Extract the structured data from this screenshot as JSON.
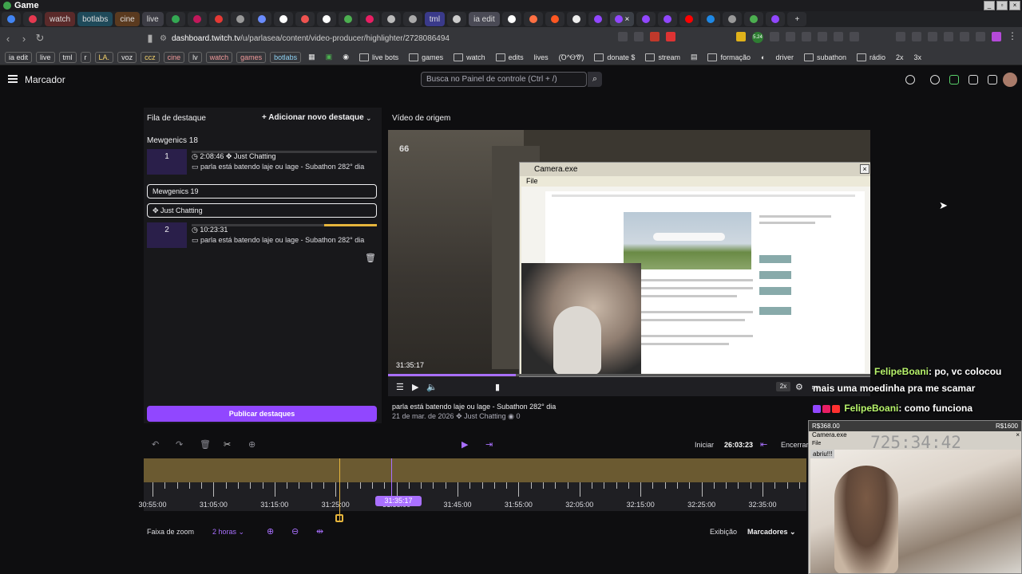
{
  "window": {
    "title": "Game"
  },
  "tabs": [
    "watch",
    "botlabs",
    "cine",
    "live",
    "tml",
    "ia edit"
  ],
  "address": {
    "host": "dashboard.twitch.tv",
    "path": "/u/parlasea/content/video-producer/highlighter/2728086494"
  },
  "bookmarks": [
    "ia edit",
    "live",
    "tml",
    "r",
    "LA.",
    "voz",
    "ccz",
    "cine",
    "lv",
    "watch",
    "games",
    "botlabs",
    "live bots",
    "games",
    "watch",
    "edits",
    "lives",
    "(Ꝺ^ᎾᏡ)",
    "donate $",
    "stream",
    "formação",
    "driver",
    "subathon",
    "rádio",
    "2x",
    "3x"
  ],
  "extension_badge": "5.24",
  "header": {
    "title": "Marcador",
    "search_placeholder": "Busca no Painel de controle (Ctrl + /)"
  },
  "queue": {
    "title": "Fila de destaque",
    "add_label": "Adicionar novo destaque",
    "groups": [
      {
        "name": "Mewgenics 18",
        "clip_num": "1",
        "clip_time": "2:08:46",
        "category": "Just Chatting",
        "clip_title": "parla está batendo laje ou lage - Subathon 282° dia"
      },
      {
        "name": "Mewgenics 19",
        "clip_num": "2",
        "clip_time": "10:23:31",
        "category": "Just Chatting",
        "clip_title": "parla está batendo laje ou lage - Subathon 282° dia"
      }
    ],
    "publish_label": "Publicar destaques"
  },
  "source": {
    "label": "Vídeo de origem",
    "current_time": "31:35:17",
    "quality": "2x",
    "overlay_counter": "66",
    "camera_window_title": "Camera.exe",
    "camera_menu": "File",
    "video_title": "parla está batendo laje ou lage - Subathon 282° dia",
    "video_date": "21 de mar. de 2026",
    "video_category": "Just Chatting",
    "video_views": "0"
  },
  "chat": [
    {
      "user": "FelipeBoani",
      "text": ": po, vc colocou"
    },
    {
      "user": "",
      "text": "mais uma moedinha pra me scamar"
    },
    {
      "user": "FelipeBoani",
      "text": ": como funciona"
    }
  ],
  "cam2": {
    "money_left": "R$368.00",
    "money_right": "R$1600",
    "window_title": "Camera.exe",
    "menu": "File",
    "timer": "725:34:42",
    "tag": "abriu!!!"
  },
  "timeline": {
    "start_label": "Iniciar",
    "start_time": "26:03:23",
    "end_label": "Encerrar",
    "ticks": [
      "30:55:00",
      "31:05:00",
      "31:15:00",
      "31:25:00",
      "31:35:00",
      "31:45:00",
      "31:55:00",
      "32:05:00",
      "32:15:00",
      "32:25:00",
      "32:35:00"
    ],
    "playhead_label": "31:35:17",
    "zoom_label": "Faixa de zoom",
    "zoom_value": "2 horas",
    "display_label": "Exibição",
    "display_value": "Marcadores"
  }
}
